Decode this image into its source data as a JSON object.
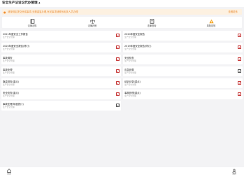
{
  "header": {
    "title": "安全生产法诉讼代办管理 ▴"
  },
  "notice": {
    "text": "请按规定提交完成事项,无需重复办理,有关事项请联系相关人员办理",
    "link": "查看更多"
  },
  "tabs": [
    {
      "label": "法律法规",
      "icon": "book-icon"
    },
    {
      "label": "法律判例",
      "icon": "scale-icon"
    },
    {
      "label": "法律咨询",
      "icon": "doc-icon"
    },
    {
      "label": "风险告知",
      "icon": "warning-icon"
    }
  ],
  "items": [
    {
      "name": "2021年度安全工作报告",
      "sub": "生产安全管理"
    },
    {
      "name": "2020年度安全报告",
      "sub": "生产安全管理"
    },
    {
      "name": "2020年度安全报告(修订)",
      "sub": "生产安全管理"
    },
    {
      "name": "2019年度安全报告(修订)",
      "sub": "生产安全管理"
    },
    {
      "name": "事故调查",
      "sub": "生产安全管理"
    },
    {
      "name": "安全检查",
      "sub": "生产安全管理"
    },
    {
      "name": "事故处理",
      "sub": "生产安全管理"
    },
    {
      "name": "应急处置",
      "sub": "生产安全管理"
    },
    {
      "name": "隐患排查(重点)",
      "sub": "生产安全管理"
    },
    {
      "name": "培训记录(重点)",
      "sub": "生产安全管理"
    },
    {
      "name": "安全检查(重点)",
      "sub": "生产安全管理"
    },
    {
      "name": "事故处理(重点)",
      "sub": "生产安全管理"
    },
    {
      "name": "事故处理(年度统计)",
      "sub": "生产安全管理"
    }
  ],
  "bottom_nav": [
    {
      "label": "首页",
      "icon": "home-icon"
    },
    {
      "label": "我的",
      "icon": "user-icon"
    }
  ],
  "colors": {
    "accent": "#f08a2b",
    "action": "#c73a3a",
    "background": "#f3f3f5"
  }
}
